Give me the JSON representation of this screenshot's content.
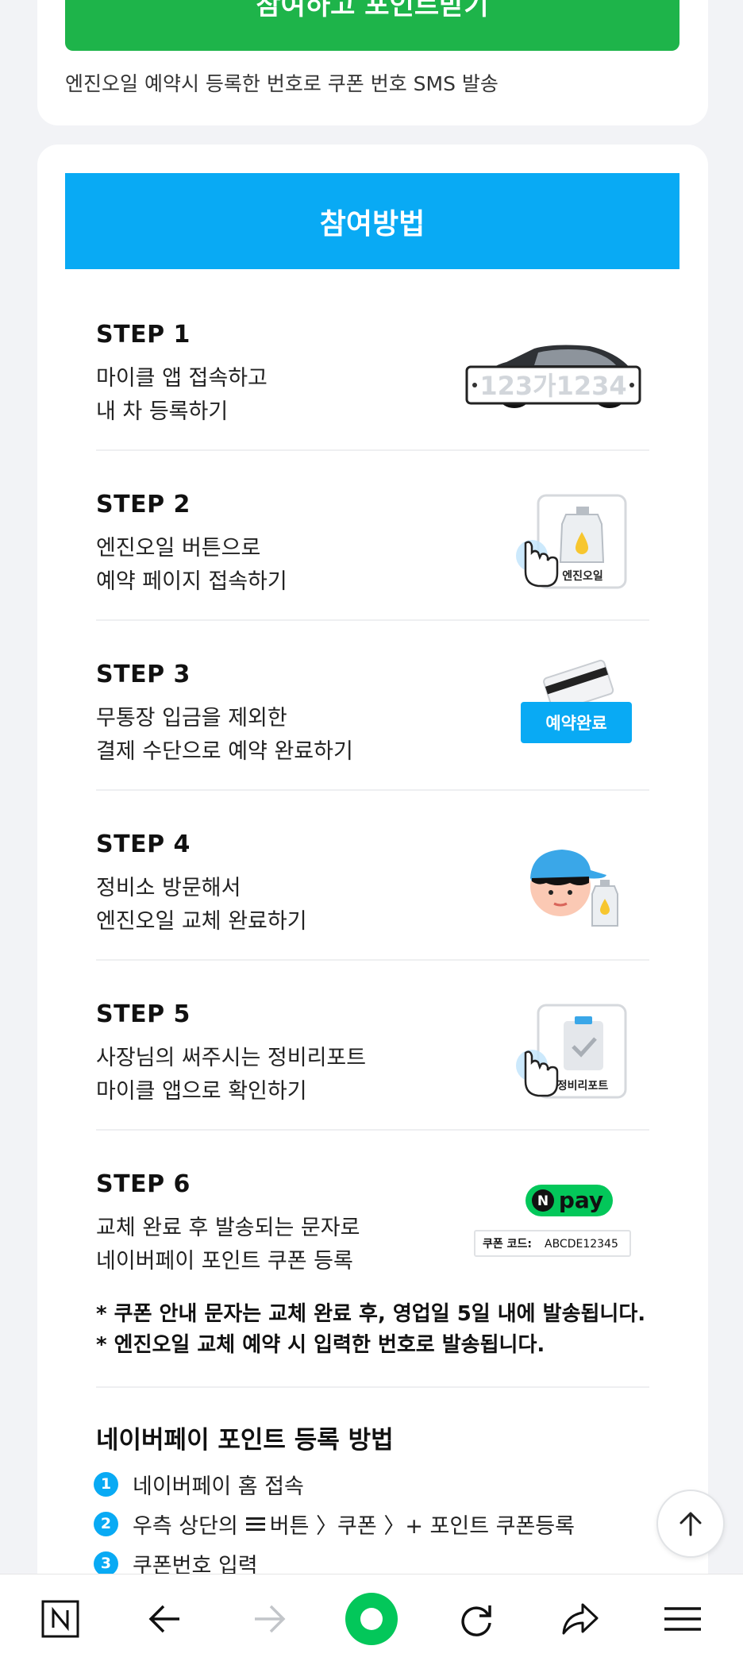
{
  "top_card": {
    "join_button_label": "참여하고 포인트받기",
    "sms_note": "엔진오일 예약시 등록한 번호로 쿠폰 번호 SMS 발송"
  },
  "how_to": {
    "banner_title": "참여방법",
    "steps": [
      {
        "title": "STEP 1",
        "line1": "마이클 앱 접속하고",
        "line2": "내 차 등록하기",
        "illustration": "car-with-plate",
        "plate_text": "123가1234"
      },
      {
        "title": "STEP 2",
        "line1": "엔진오일 버튼으로",
        "line2": "예약 페이지 접속하기",
        "illustration": "engine-oil-button",
        "button_text": "엔진오일"
      },
      {
        "title": "STEP 3",
        "line1": "무통장 입금을 제외한",
        "line2": "결제 수단으로 예약 완료하기",
        "illustration": "card-reservation",
        "button_text": "예약완료"
      },
      {
        "title": "STEP 4",
        "line1": "정비소 방문해서",
        "line2": "엔진오일 교체 완료하기",
        "illustration": "mechanic-with-oil"
      },
      {
        "title": "STEP 5",
        "line1": "사장님의 써주시는 정비리포트",
        "line2": "마이클 앱으로 확인하기",
        "illustration": "report-button",
        "button_text": "정비리포트"
      },
      {
        "title": "STEP 6",
        "line1": "교체 완료 후 발송되는 문자로",
        "line2": "네이버페이 포인트 쿠폰 등록",
        "illustration": "npay-coupon",
        "npay_text": "pay",
        "coupon_label": "쿠폰 코드:",
        "coupon_code": "ABCDE12345"
      }
    ],
    "notices": [
      "* 쿠폰 안내 문자는 교체 완료 후, 영업일 5일 내에 발송됩니다.",
      "* 엔진오일 교체 예약 시 입력한 번호로 발송됩니다."
    ]
  },
  "npay_register": {
    "title": "네이버페이 포인트 등록 방법",
    "items": [
      {
        "num": "1",
        "text": "네이버페이 홈 접속"
      },
      {
        "num": "2",
        "text_before": "우측 상단의",
        "text_after": "버튼 〉쿠폰 〉+ 포인트 쿠폰등록"
      },
      {
        "num": "3",
        "text": "쿠폰번호 입력"
      }
    ]
  },
  "colors": {
    "green": "#1eb44a",
    "blue": "#09aaf4",
    "npay_green": "#03c75a"
  },
  "bottom_nav": [
    "naver-home-icon",
    "back-icon",
    "forward-icon",
    "home-circle-icon",
    "refresh-icon",
    "share-icon",
    "menu-icon"
  ]
}
